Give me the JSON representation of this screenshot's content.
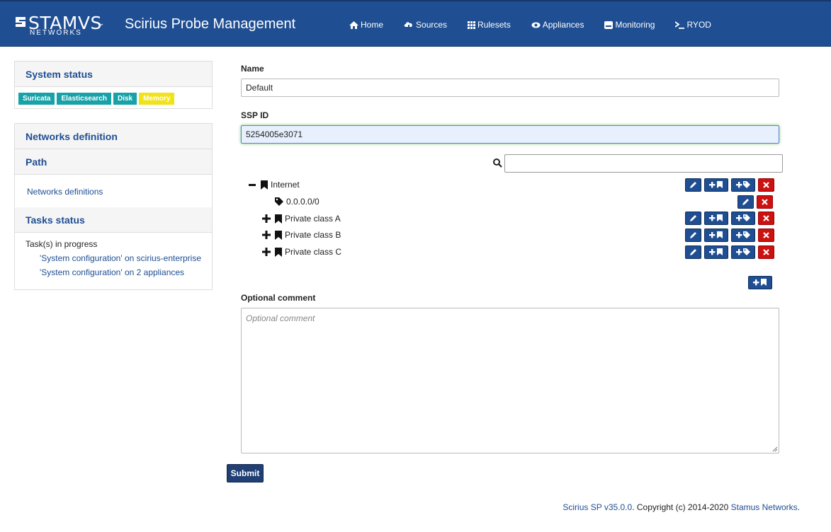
{
  "header": {
    "brand_name": "STAMVS",
    "brand_sub": "NETWORKS",
    "app_title": "Scirius Probe Management",
    "nav": [
      {
        "label": "Home",
        "icon": "home-icon"
      },
      {
        "label": "Sources",
        "icon": "cloud-download-icon"
      },
      {
        "label": "Rulesets",
        "icon": "grid-icon"
      },
      {
        "label": "Appliances",
        "icon": "eye-icon"
      },
      {
        "label": "Monitoring",
        "icon": "hdd-icon"
      },
      {
        "label": "RYOD",
        "icon": "terminal-icon"
      }
    ]
  },
  "sidebar": {
    "system_status": {
      "title": "System status",
      "badges": [
        {
          "label": "Suricata",
          "color": "#17a2a8"
        },
        {
          "label": "Elasticsearch",
          "color": "#17a2a8"
        },
        {
          "label": "Disk",
          "color": "#17a2a8"
        },
        {
          "label": "Memory",
          "color": "#f1e21a"
        }
      ]
    },
    "networks_title": "Networks definition",
    "path_title": "Path",
    "path_link": "Networks definitions",
    "tasks": {
      "title": "Tasks status",
      "in_progress": "Task(s) in progress",
      "items": [
        "'System configuration' on scirius-enterprise",
        "'System configuration' on 2 appliances"
      ]
    }
  },
  "form": {
    "name_label": "Name",
    "name_value": "Default",
    "ssp_label": "SSP ID",
    "ssp_value": "5254005e3071",
    "search_value": "",
    "tree": [
      {
        "label": "Internet",
        "toggle": "minus",
        "kind": "network"
      },
      {
        "label": "0.0.0.0/0",
        "toggle": "",
        "kind": "address"
      },
      {
        "label": "Private class A",
        "toggle": "plus",
        "kind": "network"
      },
      {
        "label": "Private class B",
        "toggle": "plus",
        "kind": "network"
      },
      {
        "label": "Private class C",
        "toggle": "plus",
        "kind": "network"
      }
    ],
    "comment_label": "Optional comment",
    "comment_placeholder": "Optional comment",
    "submit_label": "Submit"
  },
  "footer": {
    "version_link": "Scirius SP v35.0.0",
    "copyright": ". Copyright (c) 2014-2020 ",
    "company_link": "Stamus Networks",
    "end": "."
  },
  "colors": {
    "navbar": "#1f4e92",
    "accent": "#1f4e92",
    "danger": "#cc1111",
    "badge_ok": "#17a2a8",
    "badge_warn": "#f1e21a"
  }
}
